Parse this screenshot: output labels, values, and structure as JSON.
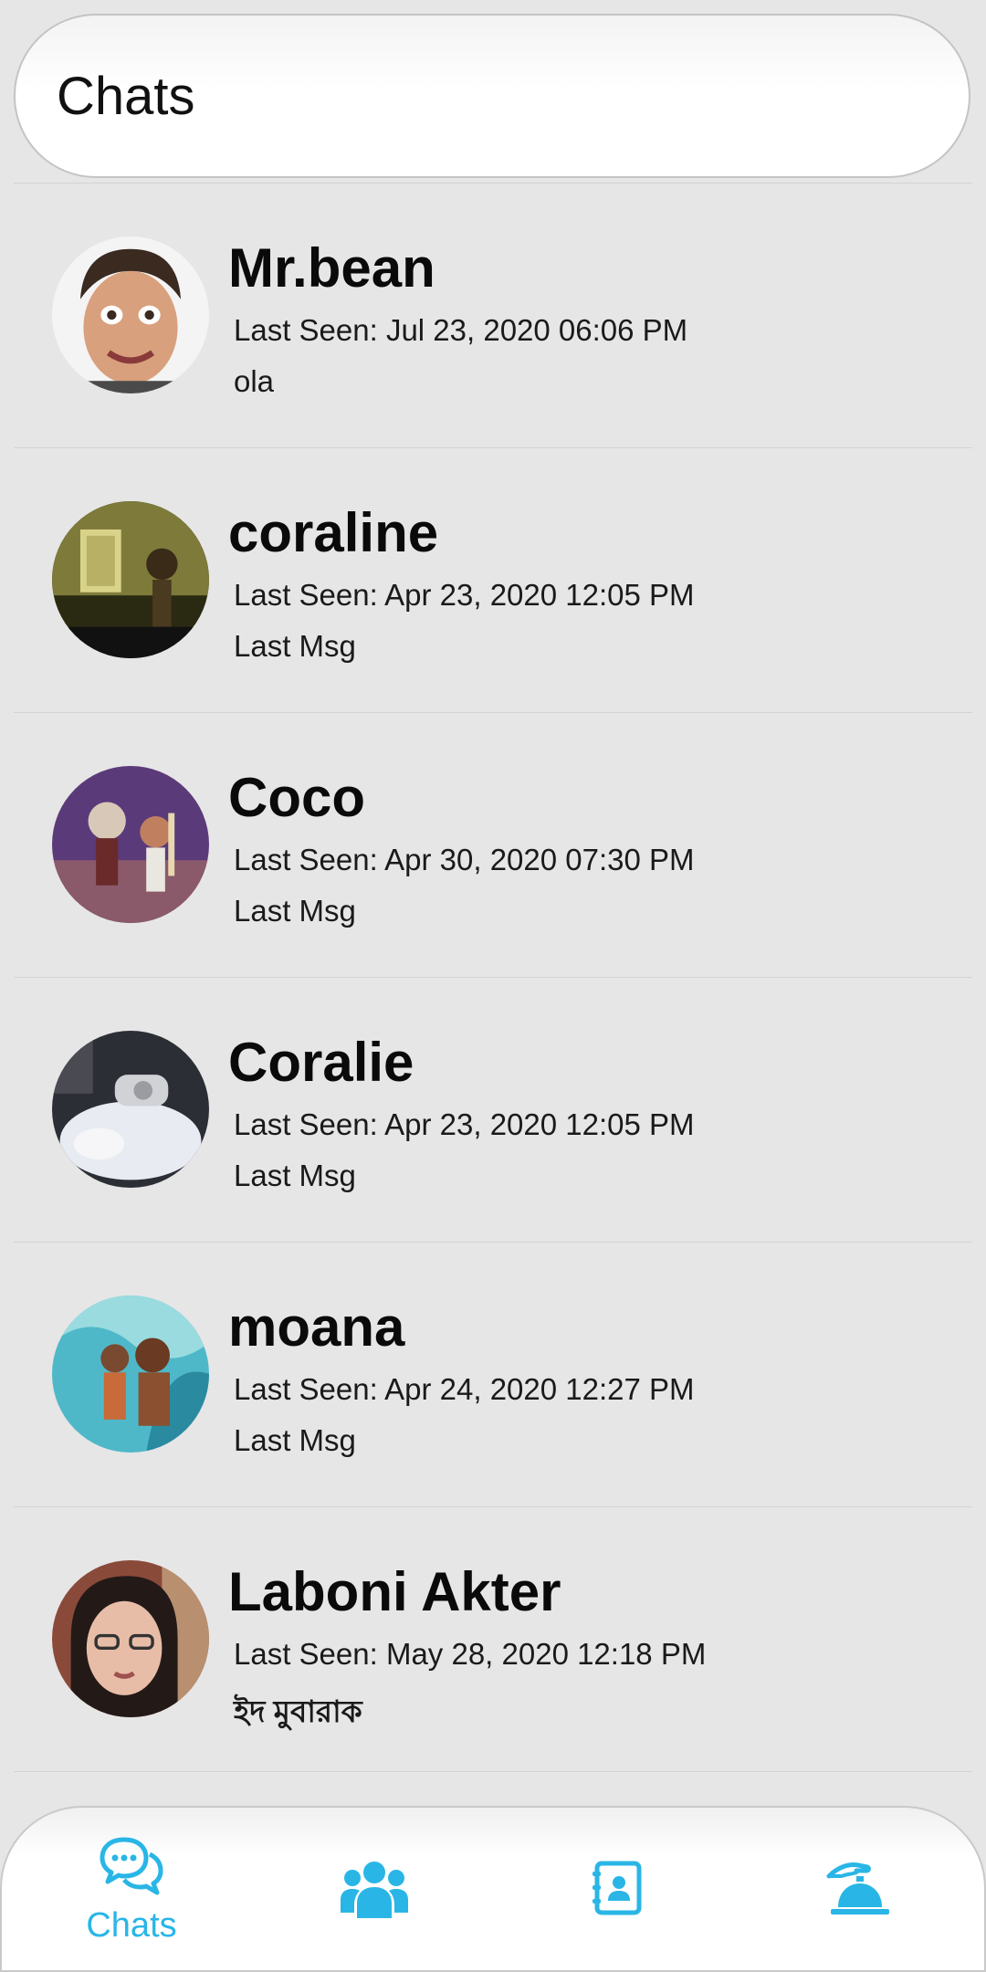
{
  "header": {
    "title": "Chats"
  },
  "chats": [
    {
      "name": "Mr.bean",
      "last_seen": "Last Seen: Jul 23, 2020 06:06 PM",
      "last_msg": "ola"
    },
    {
      "name": "coraline",
      "last_seen": "Last Seen: Apr 23, 2020 12:05 PM",
      "last_msg": "Last Msg"
    },
    {
      "name": "Coco",
      "last_seen": "Last Seen: Apr 30, 2020 07:30 PM",
      "last_msg": "Last Msg"
    },
    {
      "name": "Coralie",
      "last_seen": "Last Seen: Apr 23, 2020 12:05 PM",
      "last_msg": "Last Msg"
    },
    {
      "name": "moana",
      "last_seen": "Last Seen: Apr 24, 2020 12:27 PM",
      "last_msg": "Last Msg"
    },
    {
      "name": "Laboni Akter",
      "last_seen": "Last Seen: May 28, 2020 12:18 PM",
      "last_msg": "ইদ মুবারাক"
    }
  ],
  "nav": {
    "chats_label": "Chats",
    "items": [
      {
        "icon": "chat-bubbles-icon",
        "active": true
      },
      {
        "icon": "group-icon"
      },
      {
        "icon": "contacts-book-icon"
      },
      {
        "icon": "service-bell-icon"
      }
    ]
  },
  "colors": {
    "accent": "#29b6e6",
    "background": "#e6e6e6"
  }
}
